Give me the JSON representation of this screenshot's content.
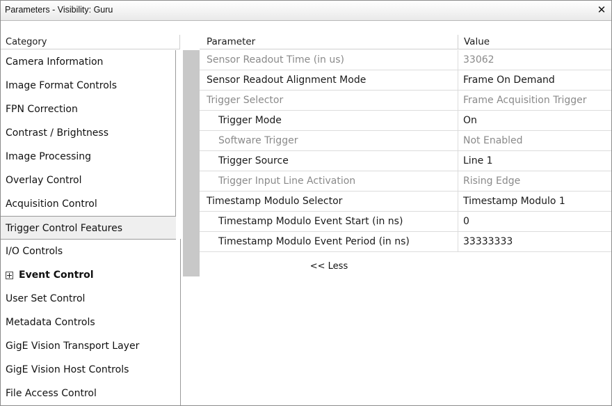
{
  "window": {
    "title": "Parameters - Visibility: Guru",
    "close_glyph": "✕"
  },
  "headers": {
    "category": "Category",
    "parameter": "Parameter",
    "value": "Value"
  },
  "categories": [
    {
      "label": "Camera Information"
    },
    {
      "label": "Image Format Controls"
    },
    {
      "label": "FPN Correction"
    },
    {
      "label": "Contrast / Brightness"
    },
    {
      "label": "Image Processing"
    },
    {
      "label": "Overlay Control"
    },
    {
      "label": "Acquisition Control"
    },
    {
      "label": "Trigger Control Features",
      "selected": true
    },
    {
      "label": "I/O Controls"
    },
    {
      "label": "Event Control",
      "expandable": true,
      "bold": true
    },
    {
      "label": "User Set Control"
    },
    {
      "label": "Metadata Controls"
    },
    {
      "label": "GigE Vision Transport Layer"
    },
    {
      "label": "GigE Vision Host Controls"
    },
    {
      "label": "File Access Control"
    }
  ],
  "parameters": [
    {
      "name": "Sensor Readout Time (in us)",
      "value": "33062",
      "enabled": false,
      "indent": 0
    },
    {
      "name": "Sensor Readout Alignment Mode",
      "value": "Frame On Demand",
      "enabled": true,
      "indent": 0
    },
    {
      "name": "Trigger Selector",
      "value": "Frame Acquisition Trigger",
      "enabled": false,
      "indent": 0
    },
    {
      "name": "Trigger Mode",
      "value": "On",
      "enabled": true,
      "indent": 1
    },
    {
      "name": "Software Trigger",
      "value": "Not Enabled",
      "enabled": false,
      "indent": 1
    },
    {
      "name": "Trigger Source",
      "value": "Line 1",
      "enabled": true,
      "indent": 1
    },
    {
      "name": "Trigger Input Line Activation",
      "value": "Rising Edge",
      "enabled": false,
      "indent": 1
    },
    {
      "name": "Timestamp Modulo Selector",
      "value": "Timestamp Modulo 1",
      "enabled": true,
      "indent": 0
    },
    {
      "name": "Timestamp Modulo Event Start (in ns)",
      "value": "0",
      "enabled": true,
      "indent": 1
    },
    {
      "name": "Timestamp Modulo Event Period (in ns)",
      "value": "33333333",
      "enabled": true,
      "indent": 1
    }
  ],
  "less_link": "<< Less",
  "colors": {
    "disabled_text": "#8a8a8a",
    "selected_bg": "#efefef",
    "strip": "#c8c8c8"
  }
}
